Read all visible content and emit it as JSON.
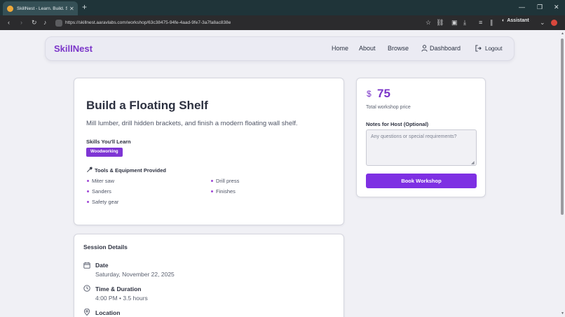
{
  "browser": {
    "tab_title": "SkillNest - Learn. Build. Share.",
    "url": "https://skillnest.aaravlabs.com/workshop/63c38475-94fe-4aad-9fe7-3a7fa8ac838e",
    "assistant_label": "Assistant"
  },
  "nav": {
    "brand": "SkillNest",
    "links": [
      "Home",
      "About",
      "Browse",
      "Dashboard"
    ],
    "logout": "Logout"
  },
  "workshop": {
    "title": "Build a Floating Shelf",
    "description": "Mill lumber, drill hidden brackets, and finish a modern floating wall shelf.",
    "skills_heading": "Skills You'll Learn",
    "skills": [
      "Woodworking"
    ],
    "tools_heading": "Tools & Equipment Provided",
    "tools": [
      "Miter saw",
      "Drill press",
      "Sanders",
      "Finishes",
      "Safety gear"
    ]
  },
  "booking": {
    "currency": "$",
    "price": "75",
    "price_label": "Total workshop price",
    "notes_label": "Notes for Host (Optional)",
    "notes_placeholder": "Any questions or special requirements?",
    "notes_value": "",
    "book_button": "Book Workshop"
  },
  "session": {
    "heading": "Session Details",
    "date_label": "Date",
    "date_value": "Saturday, November 22, 2025",
    "time_label": "Time & Duration",
    "time_value": "4:00 PM • 3.5 hours",
    "location_label": "Location"
  },
  "colors": {
    "accent": "#7b35c9",
    "button": "#7e30e3",
    "tab_bar": "#1f3439"
  }
}
